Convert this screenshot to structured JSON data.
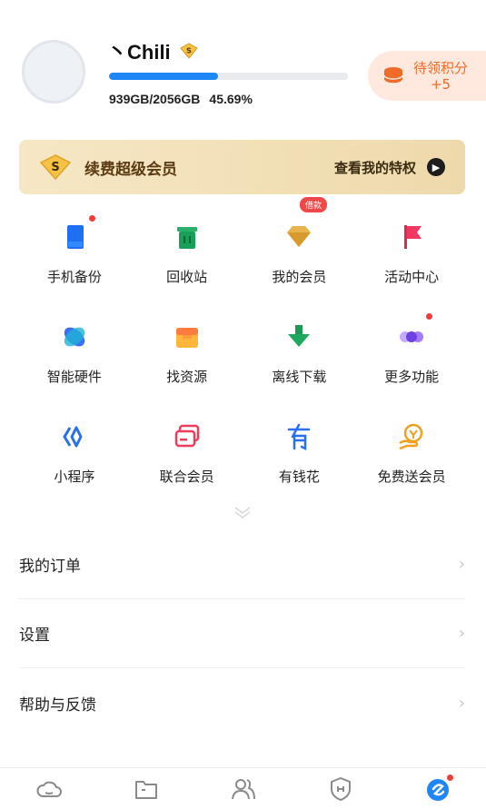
{
  "profile": {
    "username": "丶Chili",
    "storage_used_text": "939GB/2056GB",
    "storage_percent_text": "45.69%",
    "storage_fraction": 0.4569
  },
  "points": {
    "line1": "待领积分",
    "line2": "+5",
    "color": "#f06a2a"
  },
  "vip_banner": {
    "title": "续费超级会员",
    "link": "查看我的特权"
  },
  "grid": {
    "items": [
      {
        "label": "手机备份",
        "icon": "phone-backup-icon"
      },
      {
        "label": "回收站",
        "icon": "recycle-bin-icon"
      },
      {
        "label": "我的会员",
        "icon": "diamond-icon"
      },
      {
        "label": "活动中心",
        "icon": "flag-icon"
      },
      {
        "label": "智能硬件",
        "icon": "smart-hardware-icon"
      },
      {
        "label": "找资源",
        "icon": "find-resource-icon"
      },
      {
        "label": "离线下载",
        "icon": "offline-download-icon"
      },
      {
        "label": "更多功能",
        "icon": "more-functions-icon"
      },
      {
        "label": "小程序",
        "icon": "mini-program-icon"
      },
      {
        "label": "联合会员",
        "icon": "joint-member-icon"
      },
      {
        "label": "有钱花",
        "icon": "loan-icon"
      },
      {
        "label": "免费送会员",
        "icon": "free-member-icon"
      }
    ],
    "loan_tag": "借款"
  },
  "menu": {
    "items": [
      {
        "label": "我的订单"
      },
      {
        "label": "设置"
      },
      {
        "label": "帮助与反馈"
      }
    ]
  },
  "bottom_nav": {
    "tabs": [
      "cloud-icon",
      "folder-icon",
      "contacts-icon",
      "shield-icon",
      "profile-icon"
    ]
  },
  "colors": {
    "accent": "#1f86f5",
    "notification": "#f23b3b"
  }
}
